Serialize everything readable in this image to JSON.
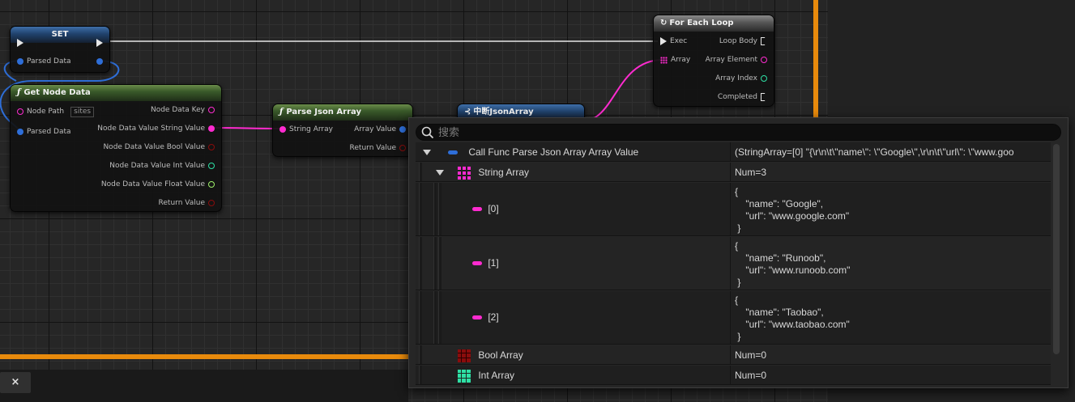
{
  "colors": {
    "accent_orange": "#e88a0c",
    "string_pin": "#ff2bd0",
    "bool_pin": "#8a0c0c",
    "int_pin": "#2ee0a5",
    "float_pin": "#9ef06a",
    "struct_pin": "#2e6ed8",
    "exec_pin": "#e6e6e6"
  },
  "nodes": {
    "set": {
      "title": "SET",
      "pin_parsed_data": "Parsed Data"
    },
    "get_node_data": {
      "title": "Get Node Data",
      "icon": "function-icon",
      "in_node_path": "Node Path",
      "in_node_path_value": "sites",
      "in_parsed_data": "Parsed Data",
      "out_key": "Node Data Key",
      "out_string": "Node Data Value String Value",
      "out_bool": "Node Data Value Bool Value",
      "out_int": "Node Data Value Int Value",
      "out_float": "Node Data Value Float Value",
      "out_return": "Return Value"
    },
    "parse_json_array": {
      "title": "Parse Json Array",
      "icon": "function-icon",
      "in_string_array": "String Array",
      "out_array_value": "Array Value",
      "out_return": "Return Value"
    },
    "break_json_array": {
      "title": "中断JsonArray",
      "icon": "break-struct-icon"
    },
    "for_each_loop": {
      "title": "For Each Loop",
      "icon": "loop-icon",
      "in_exec": "Exec",
      "in_array": "Array",
      "out_loop_body": "Loop Body",
      "out_array_element": "Array Element",
      "out_array_index": "Array Index",
      "out_completed": "Completed"
    }
  },
  "bottom_tab": {
    "close_label": "×"
  },
  "watch": {
    "search_placeholder": "搜索",
    "rows": [
      {
        "name": "Call Func Parse Json Array Array Value",
        "value": "(StringArray=[0] \"{\\r\\n\\t\\\"name\\\": \\\"Google\\\",\\r\\n\\t\\\"url\\\": \\\"www.goo",
        "icon": "struct-pin-icon"
      },
      {
        "name": "String Array",
        "value": "Num=3",
        "icon": "string-array-icon"
      },
      {
        "name": "[0]",
        "value": "{\n    \"name\": \"Google\",\n    \"url\": \"www.google.com\"\n }",
        "icon": "string-pin-icon"
      },
      {
        "name": "[1]",
        "value": "{\n    \"name\": \"Runoob\",\n    \"url\": \"www.runoob.com\"\n }",
        "icon": "string-pin-icon"
      },
      {
        "name": "[2]",
        "value": "{\n    \"name\": \"Taobao\",\n    \"url\": \"www.taobao.com\"\n }",
        "icon": "string-pin-icon"
      },
      {
        "name": "Bool Array",
        "value": "Num=0",
        "icon": "bool-array-icon"
      },
      {
        "name": "Int Array",
        "value": "Num=0",
        "icon": "int-array-icon"
      }
    ]
  }
}
